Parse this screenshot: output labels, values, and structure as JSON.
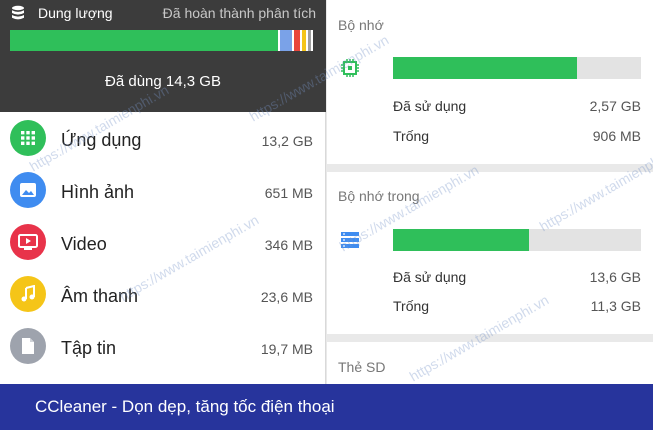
{
  "storage_header": {
    "title": "Dung lượng",
    "status": "Đã hoàn thành phân tích",
    "used_text": "Đã dùng 14,3 GB",
    "segments": [
      {
        "name": "used-green",
        "fraction": 0.885,
        "color": "#2fbf5a"
      },
      {
        "name": "blue",
        "fraction": 0.04,
        "color": "#7aa2e8"
      },
      {
        "name": "red",
        "fraction": 0.02,
        "color": "#e8453c"
      },
      {
        "name": "yellow",
        "fraction": 0.012,
        "color": "#f5c518"
      },
      {
        "name": "gray",
        "fraction": 0.01,
        "color": "#9e9e9e"
      }
    ]
  },
  "categories": [
    {
      "name": "Ứng dụng",
      "size": "13,2 GB",
      "icon": "apps-grid-icon",
      "color": "#2fbf5a"
    },
    {
      "name": "Hình ảnh",
      "size": "651 MB",
      "icon": "image-icon",
      "color": "#3f8cf0"
    },
    {
      "name": "Video",
      "size": "346 MB",
      "icon": "video-icon",
      "color": "#e8334a"
    },
    {
      "name": "Âm thanh",
      "size": "23,6 MB",
      "icon": "music-note-icon",
      "color": "#f5c518"
    },
    {
      "name": "Tập tin",
      "size": "19,7 MB",
      "icon": "file-icon",
      "color": "#9ea3ad"
    }
  ],
  "memory": {
    "title": "Bộ nhớ",
    "icon": "chip-icon",
    "fill_fraction": 0.74,
    "used_label": "Đã sử dụng",
    "used_value": "2,57 GB",
    "free_label": "Trống",
    "free_value": "906 MB"
  },
  "internal": {
    "title": "Bộ nhớ trong",
    "icon": "storage-server-icon",
    "fill_fraction": 0.55,
    "used_label": "Đã sử dụng",
    "used_value": "13,6 GB",
    "free_label": "Trống",
    "free_value": "11,3 GB"
  },
  "sd": {
    "title": "Thẻ SD"
  },
  "banner": {
    "text": "CCleaner - Dọn dẹp, tăng tốc điện thoại"
  },
  "watermark": "https://www.taimienphi.vn"
}
